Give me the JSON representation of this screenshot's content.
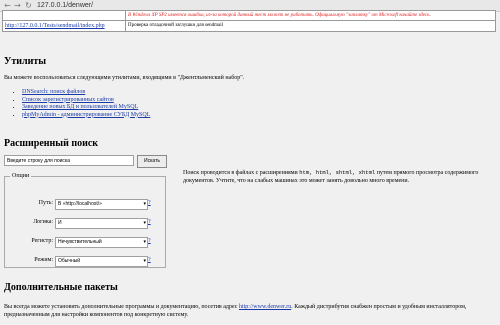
{
  "browser": {
    "url": "127.0.0.1/denwer/",
    "back_icon": "back-arrow-icon",
    "forward_icon": "forward-arrow-icon",
    "reload_icon": "reload-icon"
  },
  "top_table": {
    "error_text": "В Windows XP SP2 имеется ошибка, из-за которой данный тест может не работать. Официальную \"заплатку\" от Microsoft качайте здесь.",
    "sendmail_link": "http://127.0.0.1/Tests/sendmail/index.php",
    "sendmail_desc": "Проверка отладочной заглушки для sendmail"
  },
  "utilities": {
    "heading": "Утилиты",
    "intro": "Вы можете воспользоваться следующими утилитами, входящими в \"Джентльменский набор\".",
    "items": [
      "DNSearch: поиск файлов",
      "Список зарегистрированных сайтов",
      "Заведение новых БД и пользователей MySQL",
      "phpMyAdmin - администрирование СУБД MySQL"
    ]
  },
  "search": {
    "heading": "Расширенный поиск",
    "input_value": "Введите строку для поиска",
    "button_label": "Искать",
    "options_legend": "Опции",
    "rows": [
      {
        "label": "Путь:",
        "value": "В «http://localhost/»",
        "help": "?"
      },
      {
        "label": "Логика:",
        "value": "И",
        "help": "?"
      },
      {
        "label": "Регистр:",
        "value": "Нечувствительный",
        "help": "?"
      },
      {
        "label": "Режим:",
        "value": "Обычный",
        "help": "?"
      }
    ],
    "hint_before": "Поиск проводится в файлах с расширениями ",
    "hint_exts": "htm, html, shtml, xhtml",
    "hint_after": " путем прямого просмотра содержимого документов. Учтите, что на слабых машинах это может занять довольно много времени."
  },
  "packages": {
    "heading": "Дополнительные пакеты",
    "text_before": "Вы всегда можете установить дополнительные программы и документацию, посетив адрес ",
    "link": "http://www.denwer.ru",
    "text_after": ". Каждый дистрибутив снабжен простым и удобным инсталлятором, предназначенным для настройки компонентов под конкретную систему."
  }
}
